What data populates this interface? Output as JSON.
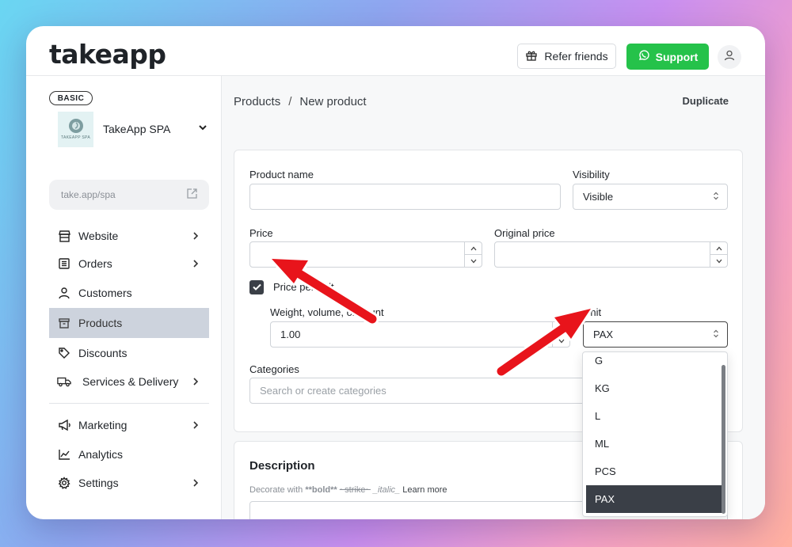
{
  "brand": {
    "logo_text": "takeapp"
  },
  "header": {
    "refer_label": "Refer friends",
    "support_label": "Support",
    "colors": {
      "support_bg": "#25c24a"
    }
  },
  "sidebar": {
    "plan_badge": "BASIC",
    "store_name": "TakeApp SPA",
    "store_logo_caption": "TAKEAPP SPA",
    "store_url": "take.app/spa",
    "items": [
      {
        "label": "Website",
        "icon": "storefront-icon",
        "has_chevron": true
      },
      {
        "label": "Orders",
        "icon": "list-icon",
        "has_chevron": true
      },
      {
        "label": "Customers",
        "icon": "user-icon",
        "has_chevron": false
      },
      {
        "label": "Products",
        "icon": "box-icon",
        "has_chevron": false,
        "active": true
      },
      {
        "label": "Discounts",
        "icon": "tag-icon",
        "has_chevron": false
      },
      {
        "label": "Services & Delivery",
        "icon": "truck-icon",
        "has_chevron": true
      },
      {
        "label": "Marketing",
        "icon": "megaphone-icon",
        "has_chevron": true
      },
      {
        "label": "Analytics",
        "icon": "chart-icon",
        "has_chevron": false
      },
      {
        "label": "Settings",
        "icon": "gear-icon",
        "has_chevron": true
      }
    ]
  },
  "breadcrumb": {
    "root": "Products",
    "separator": "/",
    "current": "New product"
  },
  "actions": {
    "duplicate_label": "Duplicate"
  },
  "form": {
    "product_name_label": "Product name",
    "product_name_value": "",
    "visibility_label": "Visibility",
    "visibility_value": "Visible",
    "price_label": "Price",
    "price_value": "",
    "original_price_label": "Original price",
    "original_price_value": "",
    "price_per_unit_label": "Price per unit",
    "price_per_unit_checked": true,
    "weight_label": "Weight, volume, or count",
    "weight_value": "1.00",
    "unit_label": "Unit",
    "unit_value": "PAX",
    "unit_options": [
      "G",
      "KG",
      "L",
      "ML",
      "PCS",
      "PAX"
    ],
    "categories_label": "Categories",
    "categories_placeholder": "Search or create categories"
  },
  "description": {
    "title": "Description",
    "hint_prefix": "Decorate with",
    "hint_bold": "**bold**",
    "hint_strike": "~strike~",
    "hint_italic": "_italic_",
    "hint_link": "Learn more"
  },
  "annotations": {
    "arrow_color": "#e8141b"
  }
}
